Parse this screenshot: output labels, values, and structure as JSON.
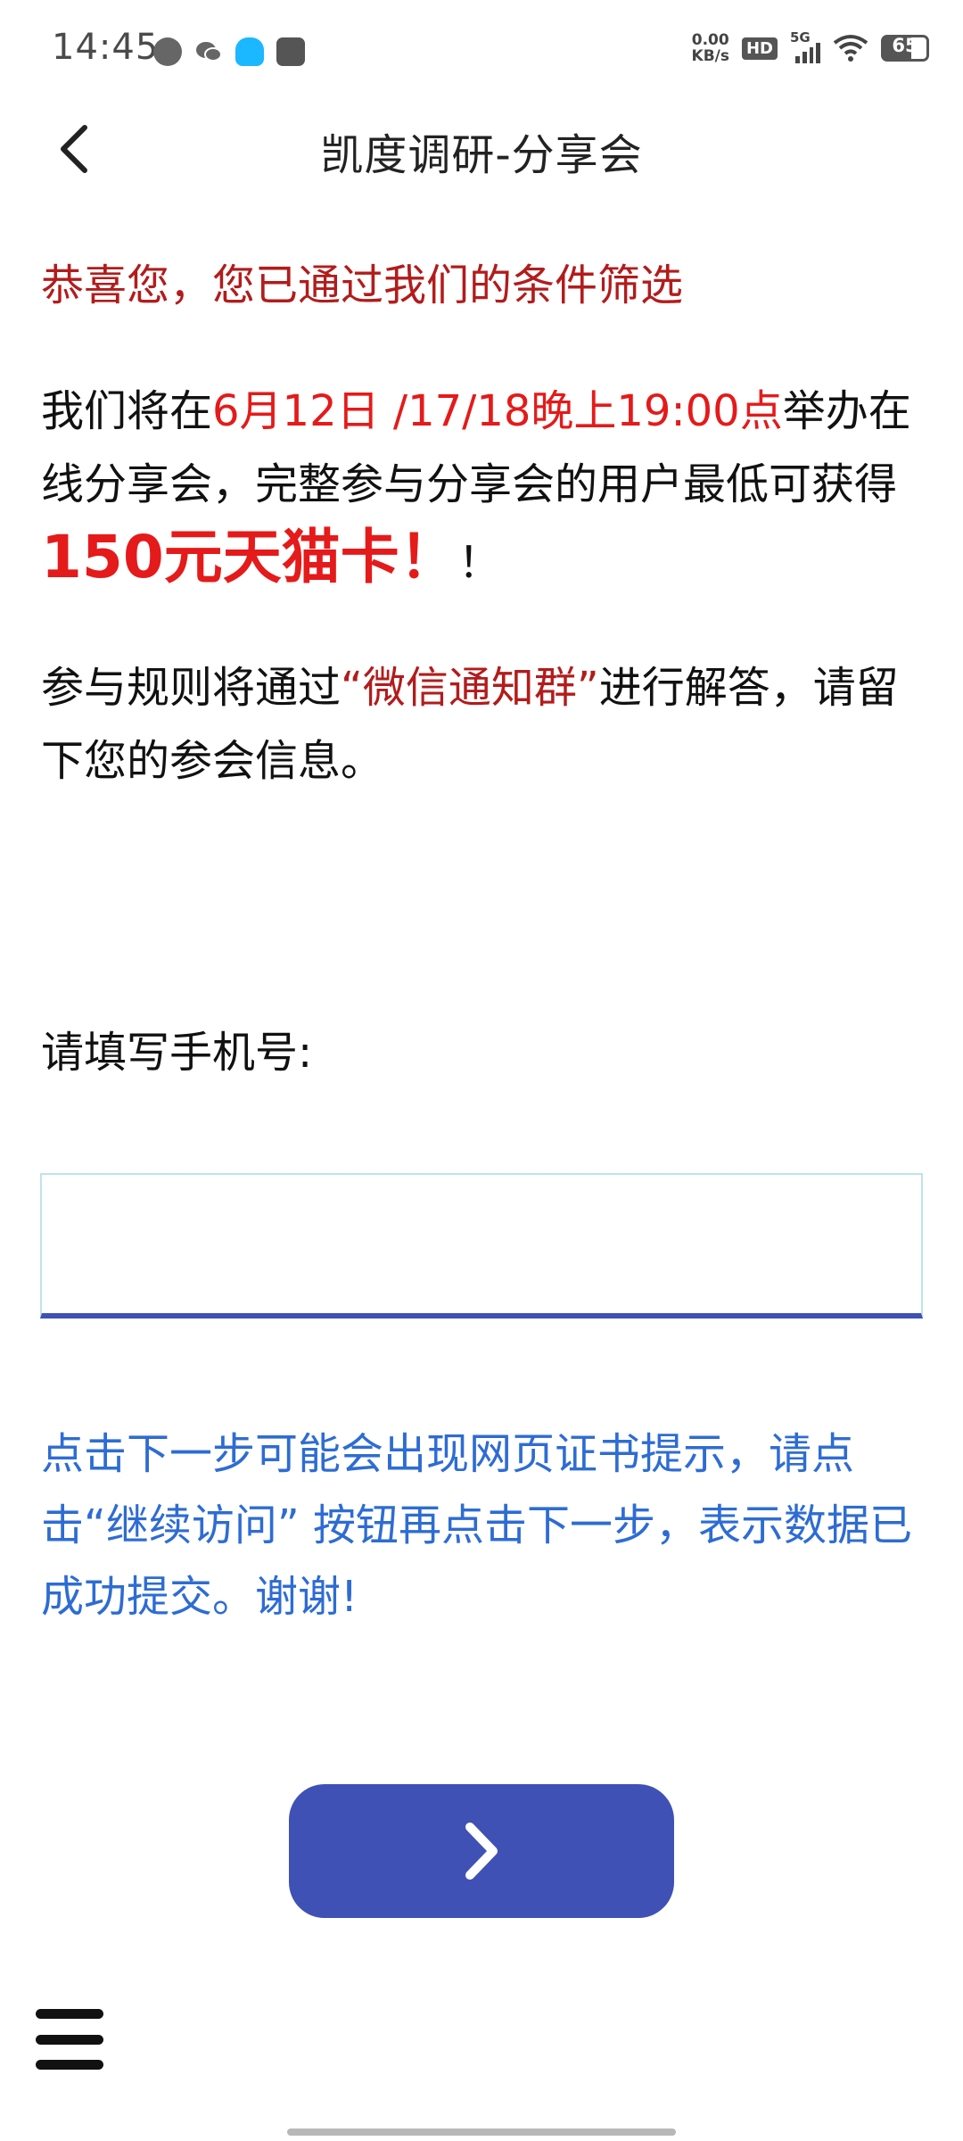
{
  "status_bar": {
    "time": "14:45",
    "net_speed_value": "0.00",
    "net_speed_unit": "KB/s",
    "hd": "HD",
    "network": "5G",
    "battery": "65"
  },
  "header": {
    "title": "凯度调研-分享会"
  },
  "content": {
    "congrats": "恭喜您，您已通过我们的条件筛选",
    "info_prefix": "我们将在",
    "info_dates": "6月12日 /17/18晚上19:00点",
    "info_middle": "举办在线分享会，完整参与分享会的用户最低可获得",
    "info_prize": "150元天猫卡！",
    "info_suffix": "！",
    "rules_prefix": "参与规则将通过",
    "rules_group": "“微信通知群”",
    "rules_suffix": "进行解答，请留下您的参会信息。",
    "phone_label": "请填写手机号:",
    "phone_value": "",
    "notice": "点击下一步可能会出现网页证书提示，请点击“继续访问” 按钮再点击下一步，表示数据已成功提交。谢谢!"
  },
  "colors": {
    "accent": "#3f51b5",
    "highlight_red": "#e51a1a",
    "dark_red": "#b21c1c",
    "notice_blue": "#2e6cd3"
  },
  "icons": {
    "back": "chevron-left-icon",
    "next": "chevron-right-icon",
    "menu": "hamburger-menu-icon"
  }
}
